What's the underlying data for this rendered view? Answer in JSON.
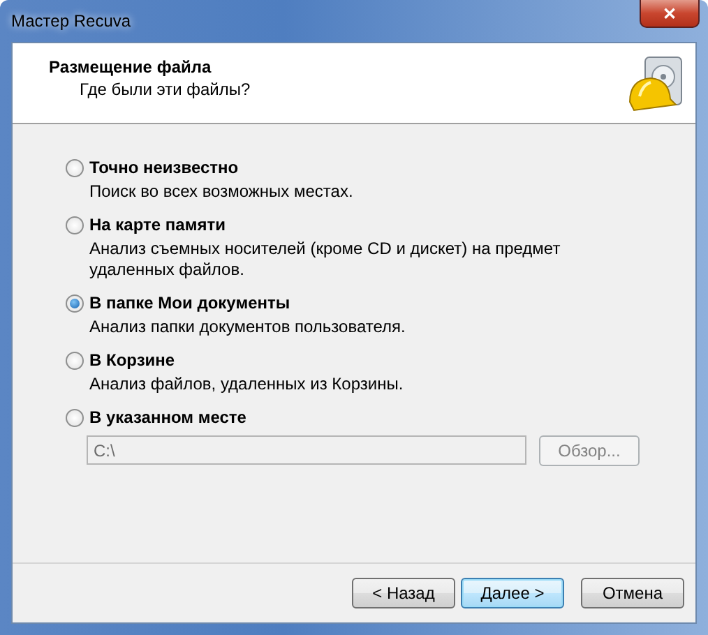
{
  "window": {
    "title": "Мастер Recuva",
    "close": "✕"
  },
  "header": {
    "title": "Размещение файла",
    "subtitle": "Где были эти файлы?"
  },
  "options": [
    {
      "label": "Точно неизвестно",
      "description": "Поиск во всех возможных местах.",
      "selected": false
    },
    {
      "label": "На карте памяти",
      "description": "Анализ съемных носителей (кроме CD и дискет) на предмет удаленных файлов.",
      "selected": false
    },
    {
      "label": "В папке Мои документы",
      "description": "Анализ папки документов пользователя.",
      "selected": true
    },
    {
      "label": "В Корзине",
      "description": "Анализ файлов, удаленных из Корзины.",
      "selected": false
    },
    {
      "label": "В указанном месте",
      "selected": false
    }
  ],
  "path_field": {
    "value": "C:\\",
    "disabled": true
  },
  "browse_button": {
    "label": "Обзор...",
    "disabled": true
  },
  "buttons": [
    {
      "label": "< Назад",
      "default": false
    },
    {
      "label": "Далее >",
      "default": true
    },
    {
      "label": "Отмена",
      "default": false
    }
  ]
}
